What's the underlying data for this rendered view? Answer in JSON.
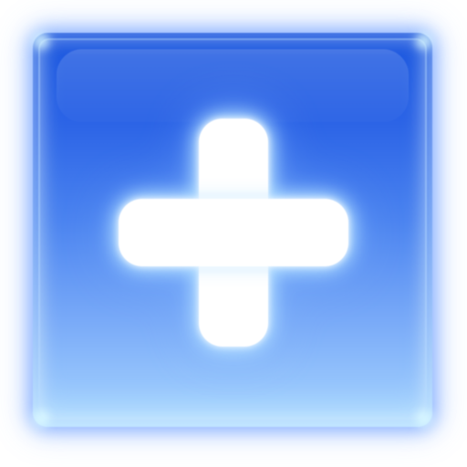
{
  "icon": {
    "name": "plus-icon",
    "semantic": "add"
  },
  "colors": {
    "background": "#ffffff",
    "button_top": "#1a56df",
    "button_bottom": "#a9d6ff",
    "glow": "#7fb8ff",
    "plus": "#ffffff"
  }
}
